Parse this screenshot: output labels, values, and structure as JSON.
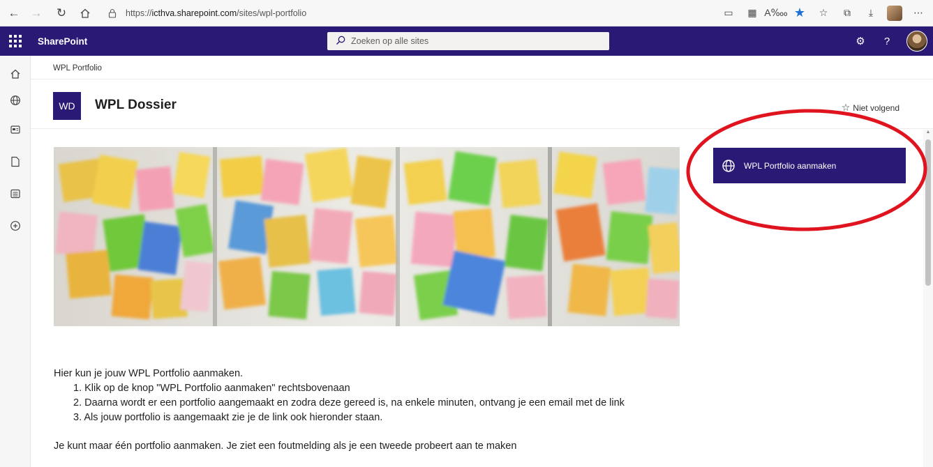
{
  "browser": {
    "url_prefix": "https://",
    "url_host": "icthva.sharepoint.com",
    "url_path": "/sites/wpl-portfolio"
  },
  "suitebar": {
    "brand": "SharePoint",
    "search_placeholder": "Zoeken op alle sites"
  },
  "site": {
    "breadcrumb": "WPL Portfolio",
    "logo_initials": "WD",
    "title": "WPL Dossier",
    "follow_label": "Niet volgend"
  },
  "cta": {
    "label": "WPL Portfolio aanmaken",
    "icon": "globe-icon"
  },
  "content": {
    "intro": "Hier kun je jouw WPL Portfolio aanmaken.",
    "steps": [
      "1. Klik op de knop \"WPL Portfolio aanmaken\" rechtsbovenaan",
      "2. Daarna wordt er een portfolio aangemaakt en zodra deze gereed is, na enkele minuten, ontvang je een email met de link",
      "3. Als jouw portfolio is aangemaakt zie je de link ook hieronder staan."
    ],
    "note": "Je kunt maar één portfolio aanmaken. Je ziet een foutmelding als je een tweede probeert aan te maken"
  },
  "colors": {
    "suitebar": "#2b1976",
    "annotation_ring": "#e0141e"
  }
}
